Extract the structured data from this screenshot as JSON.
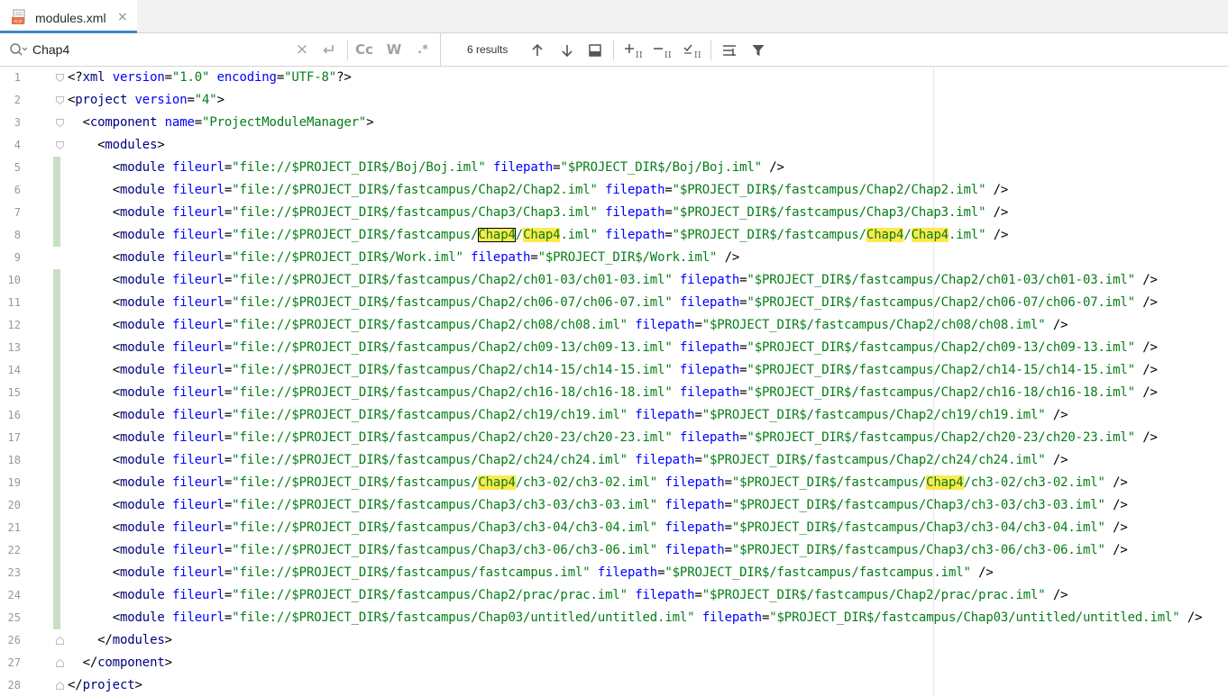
{
  "tab": {
    "label": "modules.xml",
    "close": "×"
  },
  "find": {
    "query": "Chap4",
    "clear": "×",
    "opt_case": "Cc",
    "opt_words": "W",
    "opt_regex": ".*",
    "results": "6 results"
  },
  "colors": {
    "tag": "#000080",
    "attr": "#0000ff",
    "value": "#067d17",
    "highlight": "#ffe94d",
    "changebar": "#c9dfc4",
    "tab_underline": "#4083c9"
  },
  "editor": {
    "lines": [
      {
        "no": "1",
        "indent": 0,
        "kind": "decl"
      },
      {
        "no": "2",
        "indent": 0,
        "kind": "open",
        "tag": "project",
        "attrs": [
          [
            "version",
            "\"4\""
          ]
        ]
      },
      {
        "no": "3",
        "indent": 1,
        "kind": "open",
        "tag": "component",
        "attrs": [
          [
            "name",
            "\"ProjectModuleManager\""
          ]
        ]
      },
      {
        "no": "4",
        "indent": 2,
        "kind": "open",
        "tag": "modules",
        "attrs": []
      },
      {
        "no": "5",
        "indent": 3,
        "kind": "module",
        "fileurl": "\"file://$PROJECT_DIR$/Boj/Boj.iml\"",
        "filepath": "\"$PROJECT_DIR$/Boj/Boj.iml\""
      },
      {
        "no": "6",
        "indent": 3,
        "kind": "module",
        "fileurl": "\"file://$PROJECT_DIR$/fastcampus/Chap2/Chap2.iml\"",
        "filepath": "\"$PROJECT_DIR$/fastcampus/Chap2/Chap2.iml\""
      },
      {
        "no": "7",
        "indent": 3,
        "kind": "module",
        "fileurl": "\"file://$PROJECT_DIR$/fastcampus/Chap3/Chap3.iml\"",
        "filepath": "\"$PROJECT_DIR$/fastcampus/Chap3/Chap3.iml\""
      },
      {
        "no": "8",
        "indent": 3,
        "kind": "module",
        "fileurl": "\"file://$PROJECT_DIR$/fastcampus/Chap4/Chap4.iml\"",
        "filepath": "\"$PROJECT_DIR$/fastcampus/Chap4/Chap4.iml\"",
        "current_match": 0
      },
      {
        "no": "9",
        "indent": 3,
        "kind": "module",
        "fileurl": "\"file://$PROJECT_DIR$/Work.iml\"",
        "filepath": "\"$PROJECT_DIR$/Work.iml\""
      },
      {
        "no": "10",
        "indent": 3,
        "kind": "module",
        "fileurl": "\"file://$PROJECT_DIR$/fastcampus/Chap2/ch01-03/ch01-03.iml\"",
        "filepath": "\"$PROJECT_DIR$/fastcampus/Chap2/ch01-03/ch01-03.iml\""
      },
      {
        "no": "11",
        "indent": 3,
        "kind": "module",
        "fileurl": "\"file://$PROJECT_DIR$/fastcampus/Chap2/ch06-07/ch06-07.iml\"",
        "filepath": "\"$PROJECT_DIR$/fastcampus/Chap2/ch06-07/ch06-07.iml\""
      },
      {
        "no": "12",
        "indent": 3,
        "kind": "module",
        "fileurl": "\"file://$PROJECT_DIR$/fastcampus/Chap2/ch08/ch08.iml\"",
        "filepath": "\"$PROJECT_DIR$/fastcampus/Chap2/ch08/ch08.iml\""
      },
      {
        "no": "13",
        "indent": 3,
        "kind": "module",
        "fileurl": "\"file://$PROJECT_DIR$/fastcampus/Chap2/ch09-13/ch09-13.iml\"",
        "filepath": "\"$PROJECT_DIR$/fastcampus/Chap2/ch09-13/ch09-13.iml\""
      },
      {
        "no": "14",
        "indent": 3,
        "kind": "module",
        "fileurl": "\"file://$PROJECT_DIR$/fastcampus/Chap2/ch14-15/ch14-15.iml\"",
        "filepath": "\"$PROJECT_DIR$/fastcampus/Chap2/ch14-15/ch14-15.iml\""
      },
      {
        "no": "15",
        "indent": 3,
        "kind": "module",
        "fileurl": "\"file://$PROJECT_DIR$/fastcampus/Chap2/ch16-18/ch16-18.iml\"",
        "filepath": "\"$PROJECT_DIR$/fastcampus/Chap2/ch16-18/ch16-18.iml\""
      },
      {
        "no": "16",
        "indent": 3,
        "kind": "module",
        "fileurl": "\"file://$PROJECT_DIR$/fastcampus/Chap2/ch19/ch19.iml\"",
        "filepath": "\"$PROJECT_DIR$/fastcampus/Chap2/ch19/ch19.iml\""
      },
      {
        "no": "17",
        "indent": 3,
        "kind": "module",
        "fileurl": "\"file://$PROJECT_DIR$/fastcampus/Chap2/ch20-23/ch20-23.iml\"",
        "filepath": "\"$PROJECT_DIR$/fastcampus/Chap2/ch20-23/ch20-23.iml\""
      },
      {
        "no": "18",
        "indent": 3,
        "kind": "module",
        "fileurl": "\"file://$PROJECT_DIR$/fastcampus/Chap2/ch24/ch24.iml\"",
        "filepath": "\"$PROJECT_DIR$/fastcampus/Chap2/ch24/ch24.iml\""
      },
      {
        "no": "19",
        "indent": 3,
        "kind": "module",
        "fileurl": "\"file://$PROJECT_DIR$/fastcampus/Chap4/ch3-02/ch3-02.iml\"",
        "filepath": "\"$PROJECT_DIR$/fastcampus/Chap4/ch3-02/ch3-02.iml\""
      },
      {
        "no": "20",
        "indent": 3,
        "kind": "module",
        "fileurl": "\"file://$PROJECT_DIR$/fastcampus/Chap3/ch3-03/ch3-03.iml\"",
        "filepath": "\"$PROJECT_DIR$/fastcampus/Chap3/ch3-03/ch3-03.iml\""
      },
      {
        "no": "21",
        "indent": 3,
        "kind": "module",
        "fileurl": "\"file://$PROJECT_DIR$/fastcampus/Chap3/ch3-04/ch3-04.iml\"",
        "filepath": "\"$PROJECT_DIR$/fastcampus/Chap3/ch3-04/ch3-04.iml\""
      },
      {
        "no": "22",
        "indent": 3,
        "kind": "module",
        "fileurl": "\"file://$PROJECT_DIR$/fastcampus/Chap3/ch3-06/ch3-06.iml\"",
        "filepath": "\"$PROJECT_DIR$/fastcampus/Chap3/ch3-06/ch3-06.iml\""
      },
      {
        "no": "23",
        "indent": 3,
        "kind": "module",
        "fileurl": "\"file://$PROJECT_DIR$/fastcampus/fastcampus.iml\"",
        "filepath": "\"$PROJECT_DIR$/fastcampus/fastcampus.iml\""
      },
      {
        "no": "24",
        "indent": 3,
        "kind": "module",
        "fileurl": "\"file://$PROJECT_DIR$/fastcampus/Chap2/prac/prac.iml\"",
        "filepath": "\"$PROJECT_DIR$/fastcampus/Chap2/prac/prac.iml\""
      },
      {
        "no": "25",
        "indent": 3,
        "kind": "module",
        "fileurl": "\"file://$PROJECT_DIR$/fastcampus/Chap03/untitled/untitled.iml\"",
        "filepath": "\"$PROJECT_DIR$/fastcampus/Chap03/untitled/untitled.iml\""
      },
      {
        "no": "26",
        "indent": 2,
        "kind": "close",
        "tag": "modules"
      },
      {
        "no": "27",
        "indent": 1,
        "kind": "close",
        "tag": "component"
      },
      {
        "no": "28",
        "indent": 0,
        "kind": "close",
        "tag": "project"
      }
    ],
    "decl_text": {
      "open": "<?",
      "name": "xml",
      "version_attr": "version",
      "version_val": "\"1.0\"",
      "encoding_attr": "encoding",
      "encoding_val": "\"UTF-8\"",
      "close": "?>"
    }
  }
}
